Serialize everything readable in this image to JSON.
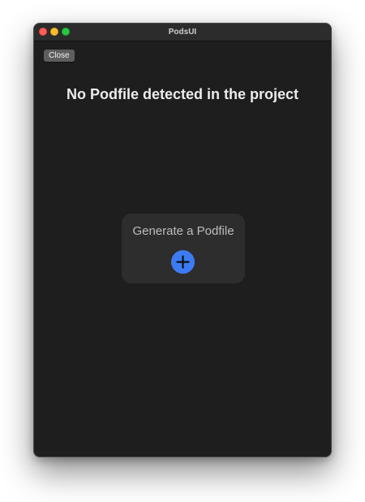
{
  "window": {
    "title": "PodsUI"
  },
  "toolbar": {
    "close_label": "Close"
  },
  "main": {
    "heading": "No Podfile detected in the project",
    "card": {
      "label": "Generate a Podfile",
      "button_icon": "plus-icon"
    }
  },
  "colors": {
    "window_bg": "#1e1e1e",
    "card_bg": "#2d2d2d",
    "accent": "#3d7bf5"
  }
}
